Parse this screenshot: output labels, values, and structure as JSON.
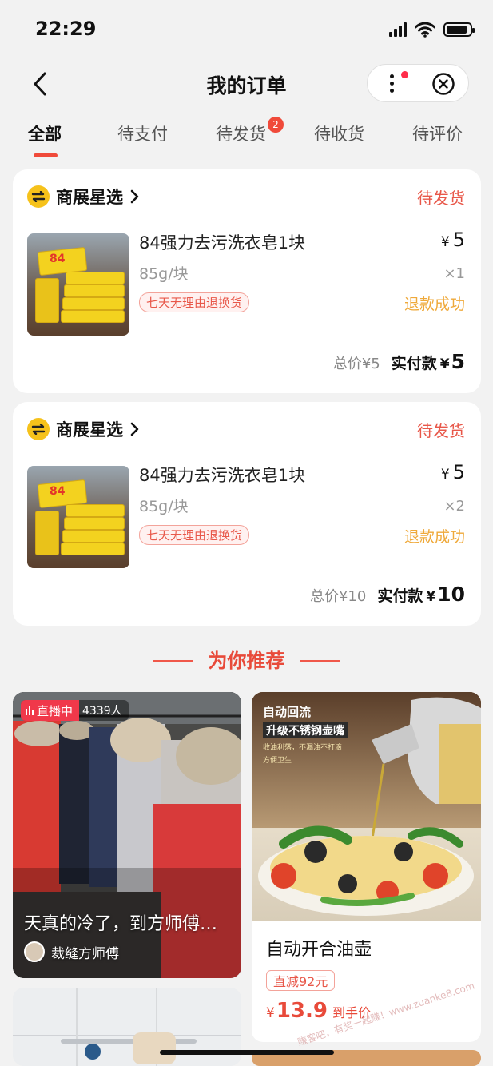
{
  "status_bar": {
    "time": "22:29",
    "battery_level": 0.9
  },
  "header": {
    "title": "我的订单"
  },
  "tabs": [
    {
      "label": "全部",
      "active": true
    },
    {
      "label": "待支付"
    },
    {
      "label": "待发货",
      "badge": "2"
    },
    {
      "label": "待收货"
    },
    {
      "label": "待评价"
    }
  ],
  "orders": [
    {
      "shop": "商展星选",
      "status": "待发货",
      "product": {
        "name": "84强力去污洗衣皂1块",
        "spec": "85g/块",
        "tag": "七天无理由退换货",
        "price_symbol": "¥",
        "price": "5",
        "qty": "×1",
        "refund": "退款成功",
        "image_label": "84"
      },
      "total_label": "总价",
      "total_value": "¥5",
      "paid_label": "实付款",
      "paid_symbol": "¥",
      "paid_value": "5"
    },
    {
      "shop": "商展星选",
      "status": "待发货",
      "product": {
        "name": "84强力去污洗衣皂1块",
        "spec": "85g/块",
        "tag": "七天无理由退换货",
        "price_symbol": "¥",
        "price": "5",
        "qty": "×2",
        "refund": "退款成功",
        "image_label": "84"
      },
      "total_label": "总价",
      "total_value": "¥10",
      "paid_label": "实付款",
      "paid_symbol": "¥",
      "paid_value": "10"
    }
  ],
  "recommend": {
    "heading": "为你推荐",
    "live_card": {
      "live_label": "直播中",
      "viewers": "4339人",
      "title": "天真的冷了，到方师傅…",
      "author": "裁缝方师傅"
    },
    "product_card": {
      "image_text_1": "自动回流",
      "image_text_2": "升级不锈钢壶嘴",
      "image_text_3": "收油利落，不漏油不打滴",
      "image_text_4": "方便卫生",
      "title": "自动开合油壶",
      "discount": "直减92元",
      "price_symbol": "¥",
      "price": "13.9",
      "price_note": "到手价"
    }
  },
  "watermark": "赚客吧，有奖一起赚！www.zuanke8.com",
  "colors": {
    "accent": "#f04a3a",
    "refund": "#efa93a",
    "background": "#f2f2f2"
  }
}
